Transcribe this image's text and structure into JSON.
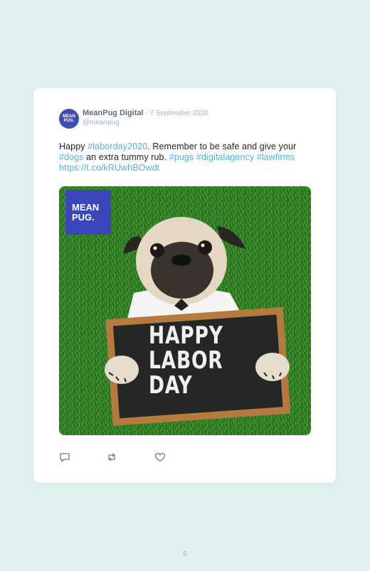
{
  "tweet": {
    "avatar_text_line1": "MEAN",
    "avatar_text_line2": "PUG.",
    "author_name": "MeanPug Digital",
    "separator": " · ",
    "date": "7 September 2020",
    "handle": "@meanpug",
    "text_parts": {
      "p1": "Happy ",
      "p2": "#laborday2020",
      "p3": ". Remember to be safe and give your ",
      "p4": "#dogs",
      "p5": " an extra tummy rub. ",
      "p6": "#pugs",
      "p7": " ",
      "p8": "#digitalagency",
      "p9": " ",
      "p10": "#lawfirms",
      "p11": "https://t.co/kRUwhBOwdt"
    },
    "image": {
      "logo_line1": "MEAN",
      "logo_line2": "PUG.",
      "sign_line1": "HAPPY",
      "sign_line2": "LABOR",
      "sign_line3": "DAY"
    },
    "actions": [
      {
        "icon": "reply-icon"
      },
      {
        "icon": "retweet-icon"
      },
      {
        "icon": "like-icon"
      }
    ]
  },
  "colors": {
    "background": "#dff0ee",
    "link": "#52aee6",
    "brand": "#3b47b8"
  },
  "page_number": "6"
}
